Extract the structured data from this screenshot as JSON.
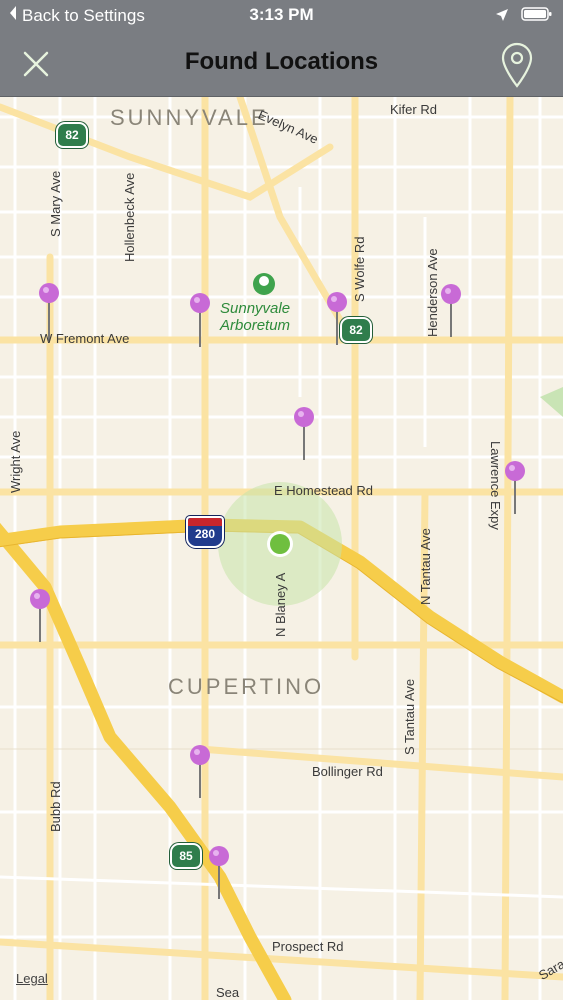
{
  "status_bar": {
    "back_label": "Back to Settings",
    "time": "3:13 PM"
  },
  "nav": {
    "title": "Found Locations"
  },
  "map": {
    "city_labels": {
      "sunnyvale": "SUNNYVALE",
      "cupertino": "CUPERTINO"
    },
    "park": {
      "line1": "Sunnyvale",
      "line2": "Arboretum"
    },
    "streets": {
      "kifer": "Kifer Rd",
      "evelyn": "Evelyn Ave",
      "s_mary": "S Mary Ave",
      "hollenbeck": "Hollenbeck Ave",
      "s_wolfe": "S Wolfe Rd",
      "henderson": "Henderson Ave",
      "w_fremont": "W Fremont Ave",
      "wright": "Wright Ave",
      "lawrence": "Lawrence Expy",
      "e_homestead": "E Homestead Rd",
      "n_tantau": "N Tantau Ave",
      "n_blaney": "N Blaney A",
      "s_tantau": "S Tantau Ave",
      "bollinger": "Bollinger Rd",
      "bubb": "Bubb Rd",
      "prospect": "Prospect Rd",
      "sara": "Sara",
      "sea": "Sea"
    },
    "shields": {
      "sr82_a": "82",
      "sr82_b": "82",
      "i280": "280",
      "sr85": "85"
    },
    "legal": "Legal",
    "pin_count": 10,
    "colors": {
      "pin": "#c86ad6",
      "current_location": "#6fbf3f",
      "freeway": "#f6cd4a",
      "arterial": "#fbe3a3"
    }
  }
}
